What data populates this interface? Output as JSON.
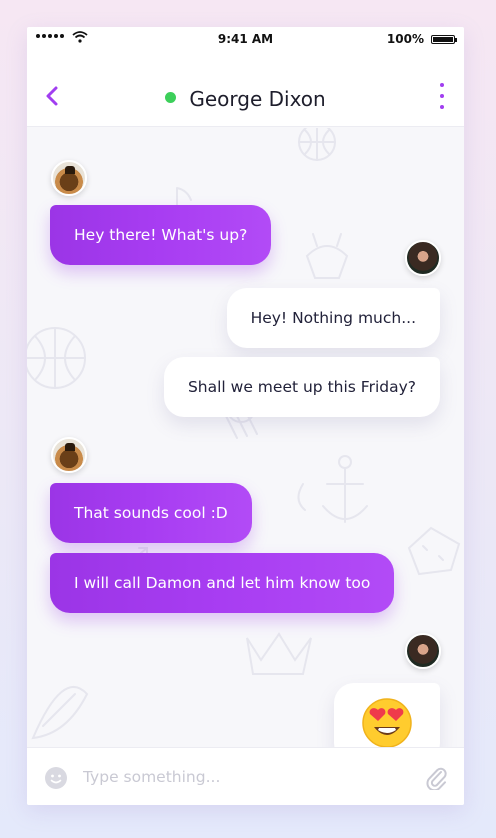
{
  "status_bar": {
    "time": "9:41 AM",
    "battery": "100%",
    "battery_level": 1.0,
    "icons": [
      "signal-dots",
      "wifi-icon",
      "battery-icon"
    ]
  },
  "header": {
    "title": "George Dixon",
    "online": true,
    "icons": [
      "back-chevron-icon",
      "online-dot",
      "more-vertical-icon"
    ]
  },
  "messages": [
    {
      "direction": "incoming",
      "text": "Hey there! What's up?"
    },
    {
      "direction": "outgoing",
      "text": "Hey! Nothing much..."
    },
    {
      "direction": "outgoing",
      "text": "Shall we meet up this Friday?"
    },
    {
      "direction": "incoming",
      "text": "That sounds cool :D"
    },
    {
      "direction": "incoming",
      "text": "I will call Damon and let him know too"
    },
    {
      "direction": "outgoing",
      "emoji": "heart-eyes-emoji"
    }
  ],
  "composer": {
    "placeholder": "Type something...",
    "value": "",
    "icons": [
      "smiley-icon",
      "paperclip-icon"
    ]
  },
  "colors": {
    "accent": "#a13ef0",
    "bubble_gradient_start": "#9b35e6",
    "bubble_gradient_end": "#b24bf6",
    "online": "#3ccf5a",
    "chat_background": "#f7f7fa"
  }
}
